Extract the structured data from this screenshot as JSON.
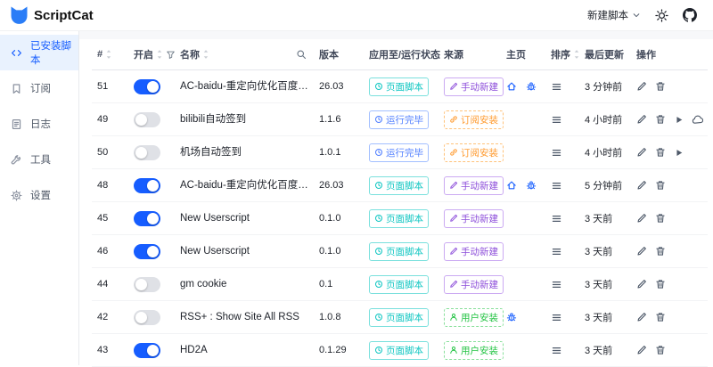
{
  "header": {
    "app_name": "ScriptCat",
    "new_script_label": "新建脚本"
  },
  "sidebar": {
    "items": [
      {
        "label": "已安装脚本",
        "icon": "code-icon",
        "selected": true
      },
      {
        "label": "订阅",
        "icon": "bookmark-icon",
        "selected": false
      },
      {
        "label": "日志",
        "icon": "file-icon",
        "selected": false
      },
      {
        "label": "工具",
        "icon": "wrench-icon",
        "selected": false
      },
      {
        "label": "设置",
        "icon": "gear-icon",
        "selected": false
      }
    ]
  },
  "table": {
    "columns": [
      "#",
      "开启",
      "名称",
      "版本",
      "应用至/运行状态",
      "来源",
      "主页",
      "排序",
      "最后更新",
      "操作"
    ],
    "rows": [
      {
        "id": "51",
        "enabled": true,
        "name": "AC-baidu-重定向优化百度搜狗谷歌...",
        "version": "26.03",
        "status": {
          "label": "页面脚本",
          "icon": "clock-icon",
          "color": "cyan"
        },
        "origin": {
          "label": "手动新建",
          "icon": "pencil-icon",
          "color": "purple"
        },
        "home_icons": [
          "home-icon",
          "bug-icon"
        ],
        "updated": "3 分钟前",
        "actions": [
          "edit-icon",
          "delete-icon"
        ]
      },
      {
        "id": "49",
        "enabled": false,
        "name": "bilibili自动签到",
        "version": "1.1.6",
        "status": {
          "label": "运行完毕",
          "icon": "clock-icon",
          "color": "blue"
        },
        "origin": {
          "label": "订阅安装",
          "icon": "link-icon",
          "color": "orange"
        },
        "home_icons": [],
        "updated": "4 小时前",
        "actions": [
          "edit-icon",
          "delete-icon",
          "run-icon",
          "cloud-icon"
        ]
      },
      {
        "id": "50",
        "enabled": false,
        "name": "机场自动签到",
        "version": "1.0.1",
        "status": {
          "label": "运行完毕",
          "icon": "clock-icon",
          "color": "blue"
        },
        "origin": {
          "label": "订阅安装",
          "icon": "link-icon",
          "color": "orange"
        },
        "home_icons": [],
        "updated": "4 小时前",
        "actions": [
          "edit-icon",
          "delete-icon",
          "run-icon"
        ]
      },
      {
        "id": "48",
        "enabled": true,
        "name": "AC-baidu-重定向优化百度搜狗谷歌...",
        "version": "26.03",
        "status": {
          "label": "页面脚本",
          "icon": "clock-icon",
          "color": "cyan"
        },
        "origin": {
          "label": "手动新建",
          "icon": "pencil-icon",
          "color": "purple"
        },
        "home_icons": [
          "home-icon",
          "bug-icon"
        ],
        "updated": "5 分钟前",
        "actions": [
          "edit-icon",
          "delete-icon"
        ]
      },
      {
        "id": "45",
        "enabled": true,
        "name": "New Userscript",
        "version": "0.1.0",
        "status": {
          "label": "页面脚本",
          "icon": "clock-icon",
          "color": "cyan"
        },
        "origin": {
          "label": "手动新建",
          "icon": "pencil-icon",
          "color": "purple"
        },
        "home_icons": [],
        "updated": "3 天前",
        "actions": [
          "edit-icon",
          "delete-icon"
        ]
      },
      {
        "id": "46",
        "enabled": true,
        "name": "New Userscript",
        "version": "0.1.0",
        "status": {
          "label": "页面脚本",
          "icon": "clock-icon",
          "color": "cyan"
        },
        "origin": {
          "label": "手动新建",
          "icon": "pencil-icon",
          "color": "purple"
        },
        "home_icons": [],
        "updated": "3 天前",
        "actions": [
          "edit-icon",
          "delete-icon"
        ]
      },
      {
        "id": "44",
        "enabled": false,
        "name": "gm cookie",
        "version": "0.1",
        "status": {
          "label": "页面脚本",
          "icon": "clock-icon",
          "color": "cyan"
        },
        "origin": {
          "label": "手动新建",
          "icon": "pencil-icon",
          "color": "purple"
        },
        "home_icons": [],
        "updated": "3 天前",
        "actions": [
          "edit-icon",
          "delete-icon"
        ]
      },
      {
        "id": "42",
        "enabled": false,
        "name": "RSS+ : Show Site All RSS",
        "version": "1.0.8",
        "status": {
          "label": "页面脚本",
          "icon": "clock-icon",
          "color": "cyan"
        },
        "origin": {
          "label": "用户安装",
          "icon": "user-icon",
          "color": "green"
        },
        "home_icons": [
          "bug-icon"
        ],
        "updated": "3 天前",
        "actions": [
          "edit-icon",
          "delete-icon"
        ]
      },
      {
        "id": "43",
        "enabled": true,
        "name": "HD2A",
        "version": "0.1.29",
        "status": {
          "label": "页面脚本",
          "icon": "clock-icon",
          "color": "cyan"
        },
        "origin": {
          "label": "用户安装",
          "icon": "user-icon",
          "color": "green"
        },
        "home_icons": [],
        "updated": "3 天前",
        "actions": [
          "edit-icon",
          "delete-icon"
        ]
      }
    ]
  },
  "colors": {
    "primary": "#165dff",
    "logo_blue": "#2a7df7",
    "badge_cyan": "#0fc6c2",
    "badge_blue": "#4f7eff",
    "badge_purple": "#8d4eda",
    "badge_orange": "#ff9a2e",
    "badge_green": "#23c343"
  }
}
